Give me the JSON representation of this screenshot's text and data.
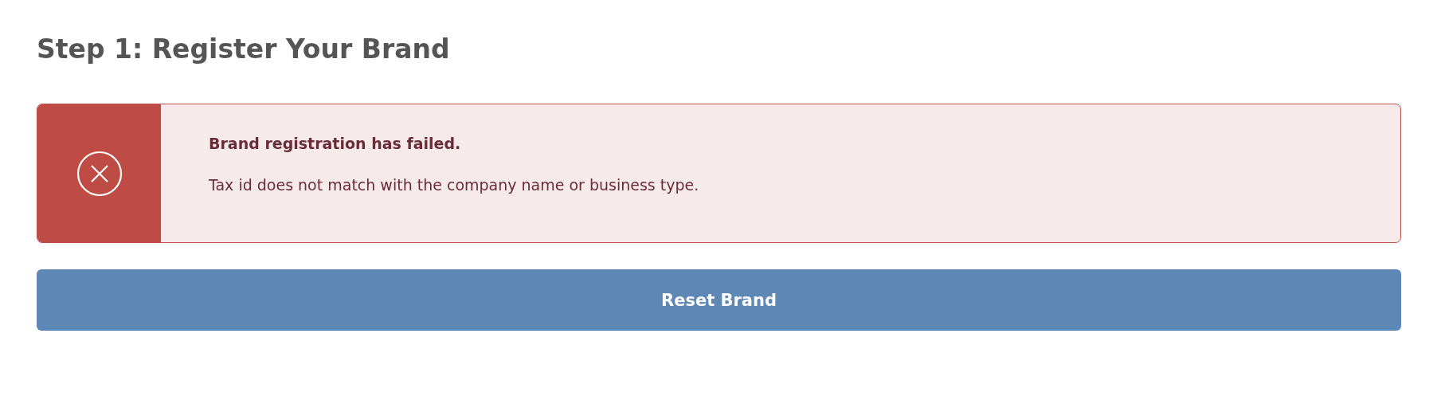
{
  "heading": "Step 1: Register Your Brand",
  "alert": {
    "kind": "error",
    "title": "Brand registration has failed.",
    "message": "Tax id does not match with the company name or business type."
  },
  "button": {
    "label": "Reset Brand"
  }
}
